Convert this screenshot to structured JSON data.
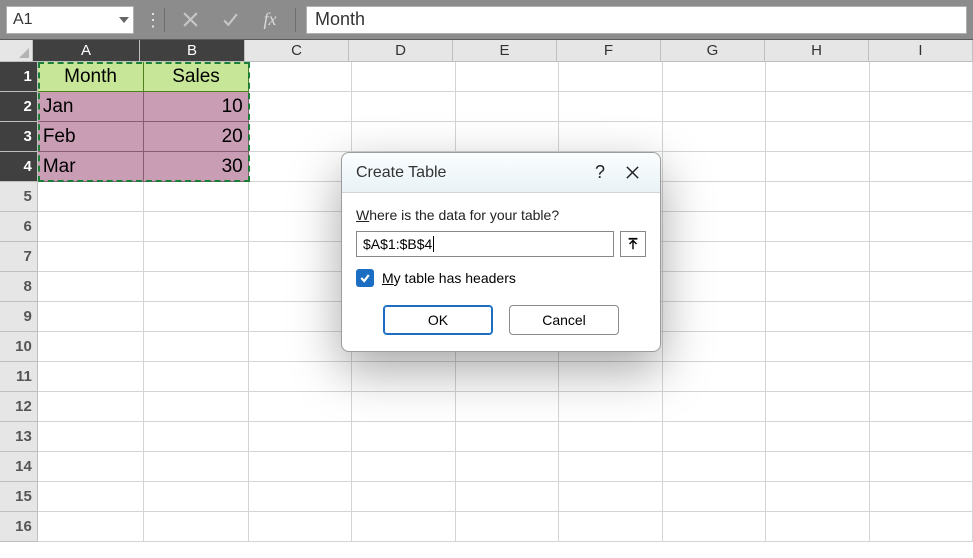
{
  "namebox": "A1",
  "formula_value": "Month",
  "columns": [
    "A",
    "B",
    "C",
    "D",
    "E",
    "F",
    "G",
    "H",
    "I"
  ],
  "row_numbers": [
    1,
    2,
    3,
    4,
    5,
    6,
    7,
    8,
    9,
    10,
    11,
    12,
    13,
    14,
    15,
    16
  ],
  "selected_cols": [
    "A",
    "B"
  ],
  "selected_rows": [
    1,
    2,
    3,
    4
  ],
  "table": {
    "headers": [
      "Month",
      "Sales"
    ],
    "rows": [
      {
        "month": "Jan",
        "sales": 10
      },
      {
        "month": "Feb",
        "sales": 20
      },
      {
        "month": "Mar",
        "sales": 30
      }
    ]
  },
  "dialog": {
    "title": "Create Table",
    "prompt_prefix": "W",
    "prompt_rest": "here is the data for your table?",
    "range": "$A$1:$B$4",
    "headers_prefix": "M",
    "headers_rest": "y table has headers",
    "headers_checked": true,
    "ok": "OK",
    "cancel": "Cancel"
  }
}
